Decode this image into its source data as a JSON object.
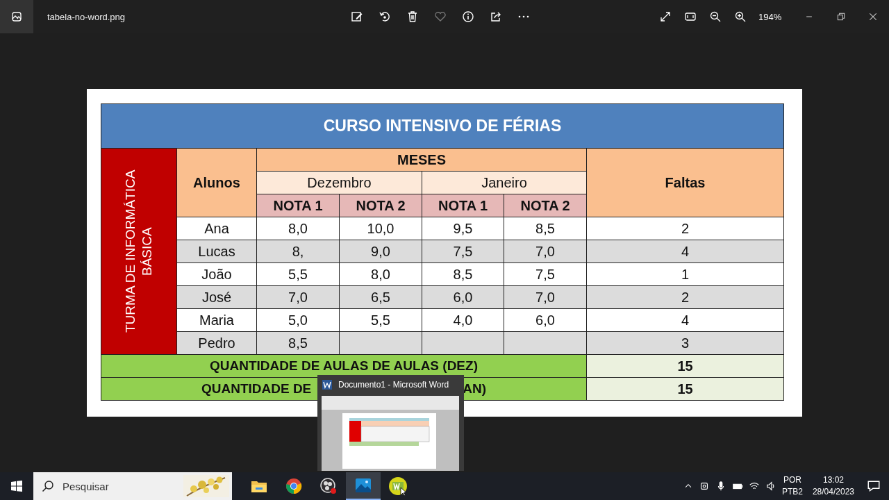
{
  "title_bar": {
    "file_name": "tabela-no-word.png",
    "zoom": "194%"
  },
  "toolbar": [
    {
      "kind": "edit",
      "disabled": false
    },
    {
      "kind": "rotate",
      "disabled": false
    },
    {
      "kind": "delete",
      "disabled": false
    },
    {
      "kind": "favorite",
      "disabled": true
    },
    {
      "kind": "info",
      "disabled": false
    },
    {
      "kind": "share",
      "disabled": false
    },
    {
      "kind": "more",
      "disabled": false
    }
  ],
  "table": {
    "title": "CURSO INTENSIVO DE FÉRIAS",
    "side_label": "TURMA DE INFORMÁTICA BÁSICA",
    "students_header": "Alunos",
    "months_header": "MESES",
    "months": [
      "Dezembro",
      "Janeiro"
    ],
    "grade_headers": [
      "NOTA 1",
      "NOTA 2",
      "NOTA 1",
      "NOTA 2"
    ],
    "absences_header": "Faltas",
    "rows": [
      {
        "name": "Ana",
        "grades": [
          "8,0",
          "10,0",
          "9,5",
          "8,5"
        ],
        "absences": "2"
      },
      {
        "name": "Lucas",
        "grades": [
          "8,",
          "9,0",
          "7,5",
          "7,0"
        ],
        "absences": "4"
      },
      {
        "name": "João",
        "grades": [
          "5,5",
          "8,0",
          "8,5",
          "7,5"
        ],
        "absences": "1"
      },
      {
        "name": "José",
        "grades": [
          "7,0",
          "6,5",
          "6,0",
          "7,0"
        ],
        "absences": "2"
      },
      {
        "name": "Maria",
        "grades": [
          "5,0",
          "5,5",
          "4,0",
          "6,0"
        ],
        "absences": "4"
      },
      {
        "name": "Pedro",
        "grades": [
          "8,5"
        ],
        "absences": "3"
      }
    ],
    "totals": [
      {
        "label": "QUANTIDADE DE AULAS DE AULAS (DEZ)",
        "value": "15"
      },
      {
        "label_start": "QUANTIDADE DE",
        "label_end": "AN)",
        "value": "15"
      }
    ]
  },
  "preview_popup": {
    "title": "Documento1 - Microsoft Word"
  },
  "taskbar": {
    "search_placeholder": "Pesquisar",
    "apps": [
      {
        "kind": "explorer",
        "selected": false
      },
      {
        "kind": "chrome",
        "selected": false
      },
      {
        "kind": "obs",
        "selected": false
      },
      {
        "kind": "photos",
        "selected": true
      },
      {
        "kind": "word",
        "selected": false
      }
    ],
    "language": "POR",
    "layout": "PTB2",
    "time": "13:02",
    "date": "28/04/2023"
  }
}
